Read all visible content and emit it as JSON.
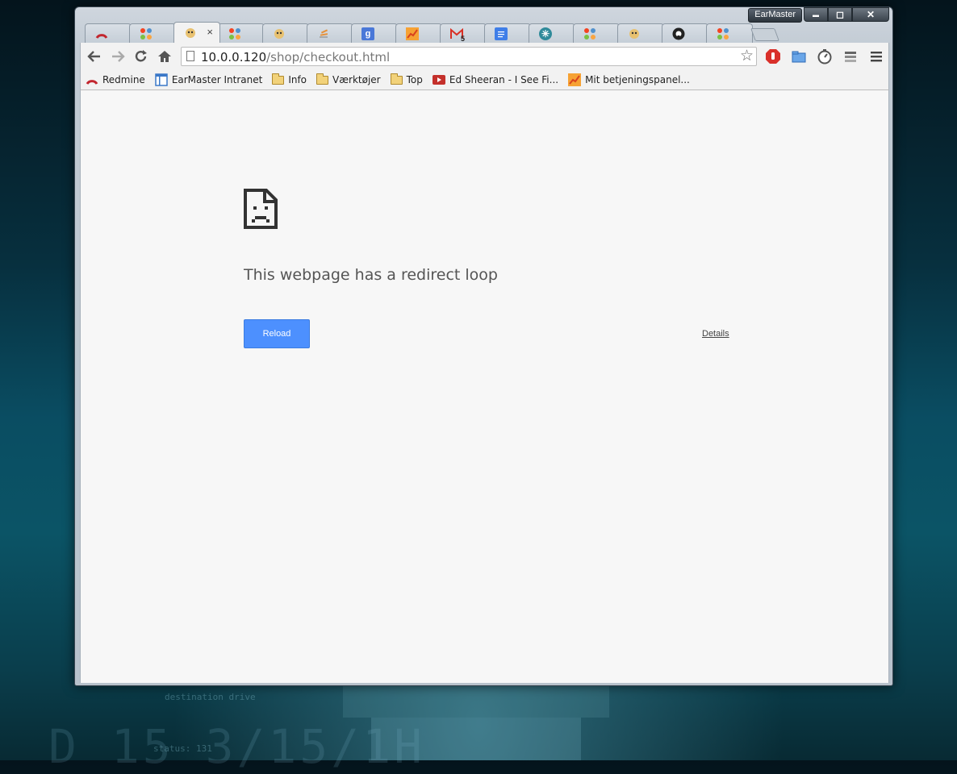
{
  "window": {
    "profile_name": "EarMaster",
    "controls": {
      "minimize": "▬",
      "maximize": "◻",
      "close": "✕"
    }
  },
  "tabs": [
    {
      "icon": "redmine-icon",
      "active": false
    },
    {
      "icon": "joomla-icon",
      "active": false
    },
    {
      "icon": "tampermonkey-icon",
      "active": true,
      "close": "×"
    },
    {
      "icon": "joomla-icon",
      "active": false
    },
    {
      "icon": "tampermonkey-icon",
      "active": false
    },
    {
      "icon": "stackoverflow-icon",
      "active": false
    },
    {
      "icon": "google-icon",
      "active": false,
      "glyph": "g"
    },
    {
      "icon": "analytics-icon",
      "active": false
    },
    {
      "icon": "gmail-icon",
      "active": false,
      "badge": "5"
    },
    {
      "icon": "docs-icon",
      "active": false
    },
    {
      "icon": "snowflake-icon",
      "active": false
    },
    {
      "icon": "joomla-icon",
      "active": false
    },
    {
      "icon": "tampermonkey-icon",
      "active": false
    },
    {
      "icon": "github-icon",
      "active": false
    },
    {
      "icon": "joomla-icon",
      "active": false
    }
  ],
  "toolbar": {
    "url_host": "10.0.0.120",
    "url_path": "/shop/checkout.html"
  },
  "bookmarks": [
    {
      "label": "Redmine",
      "icon": "redmine-icon"
    },
    {
      "label": "EarMaster Intranet",
      "icon": "intranet-icon"
    },
    {
      "label": "Info",
      "icon": "folder-icon"
    },
    {
      "label": "Værktøjer",
      "icon": "folder-icon"
    },
    {
      "label": "Top",
      "icon": "folder-icon"
    },
    {
      "label": "Ed Sheeran - I See Fi...",
      "icon": "youtube-icon"
    },
    {
      "label": "Mit betjeningspanel...",
      "icon": "analytics-icon"
    }
  ],
  "error": {
    "title": "This webpage has a redirect loop",
    "reload_label": "Reload",
    "details_label": "Details"
  },
  "desktop": {
    "text_line_1": "destination drive",
    "text_line_2": "status: 131",
    "big_text": "D 15 3/15/1H"
  },
  "colors": {
    "reload_button": "#4d90fe",
    "content_bg": "#f7f7f7",
    "adblock_red": "#d9302a"
  }
}
